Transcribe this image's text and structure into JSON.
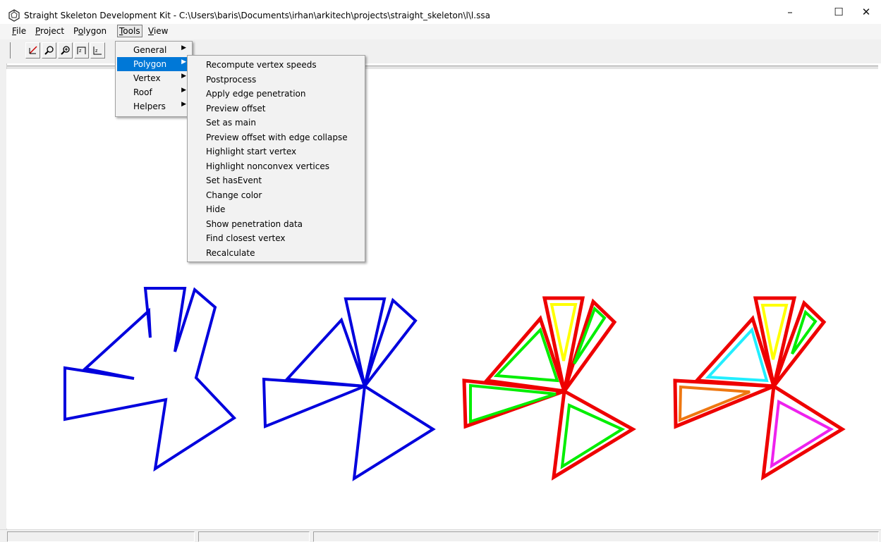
{
  "window": {
    "title": "Straight Skeleton Development Kit - C:\\Users\\baris\\Documents\\irhan\\arkitech\\projects\\straight_skeleton\\l\\l.ssa",
    "minimize_glyph": "–",
    "maximize_glyph": "☐",
    "close_glyph": "✕"
  },
  "menubar": {
    "items": [
      {
        "label": "File"
      },
      {
        "label": "Project"
      },
      {
        "label": "Polygon"
      },
      {
        "label": "Tools",
        "active": true
      },
      {
        "label": "View"
      }
    ]
  },
  "toolbar": {
    "buttons": [
      {
        "icon": "axis-icon"
      },
      {
        "icon": "zoom-icon"
      },
      {
        "icon": "zoom-in-icon"
      },
      {
        "icon": "fit-icon"
      },
      {
        "icon": "extent-icon"
      }
    ]
  },
  "tools_menu": {
    "items": [
      {
        "label": "General",
        "submenu": true
      },
      {
        "label": "Polygon",
        "submenu": true,
        "highlighted": true
      },
      {
        "label": "Vertex",
        "submenu": true
      },
      {
        "label": "Roof",
        "submenu": true
      },
      {
        "label": "Helpers",
        "submenu": true
      }
    ]
  },
  "polygon_menu": {
    "items": [
      "Recompute vertex speeds",
      "Postprocess",
      "Apply edge penetration",
      "Preview offset",
      "Set as main",
      "Preview offset with edge collapse",
      "Highlight start vertex",
      "Highlight nonconvex vertices",
      "Set hasEvent",
      "Change color",
      "Hide",
      "Show penetration data",
      "Find closest vertex",
      "Recalculate"
    ]
  },
  "canvas": {
    "colors": {
      "blue": "#0000dd",
      "red": "#ee0000",
      "yellow": "#ffff00",
      "green": "#00ee00",
      "cyan": "#22eeff",
      "orange": "#ee7711",
      "magenta": "#ee22ee"
    }
  },
  "statusbar": {
    "panels": [
      "",
      "",
      ""
    ]
  }
}
